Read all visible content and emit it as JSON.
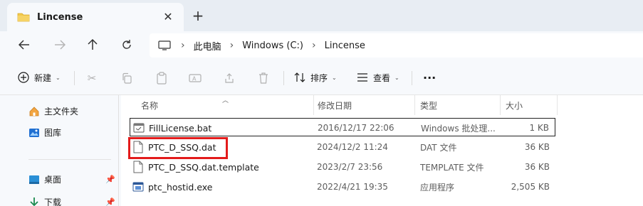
{
  "window": {
    "tab_title": "Lincense",
    "close_label": "✕",
    "new_tab_label": "+"
  },
  "breadcrumb": [
    "此电脑",
    "Windows (C:)",
    "Lincense"
  ],
  "toolbar": {
    "new_label": "新建",
    "sort_label": "排序",
    "view_label": "查看",
    "more_label": "···"
  },
  "sidebar": {
    "items": [
      {
        "label": "主文件夹",
        "icon": "home-icon"
      },
      {
        "label": "图库",
        "icon": "gallery-icon"
      },
      {
        "label": "桌面",
        "icon": "desktop-icon",
        "pinned": true
      },
      {
        "label": "下载",
        "icon": "download-icon",
        "pinned": true
      }
    ]
  },
  "columns": {
    "name": "名称",
    "date": "修改日期",
    "type": "类型",
    "size": "大小"
  },
  "files": [
    {
      "name": "FillLicense.bat",
      "date": "2016/12/17 22:06",
      "type": "Windows 批处理...",
      "size": "1 KB",
      "icon": "batch-file-icon"
    },
    {
      "name": "PTC_D_SSQ.dat",
      "date": "2024/12/2 11:24",
      "type": "DAT 文件",
      "size": "36 KB",
      "icon": "file-icon"
    },
    {
      "name": "PTC_D_SSQ.dat.template",
      "date": "2023/2/7 23:56",
      "type": "TEMPLATE 文件",
      "size": "36 KB",
      "icon": "file-icon"
    },
    {
      "name": "ptc_hostid.exe",
      "date": "2022/4/21 19:35",
      "type": "应用程序",
      "size": "2,505 KB",
      "icon": "exe-icon"
    }
  ],
  "colors": {
    "highlight": "#e31b1b",
    "folder": "#f2c94c",
    "accent": "#0067c0"
  }
}
